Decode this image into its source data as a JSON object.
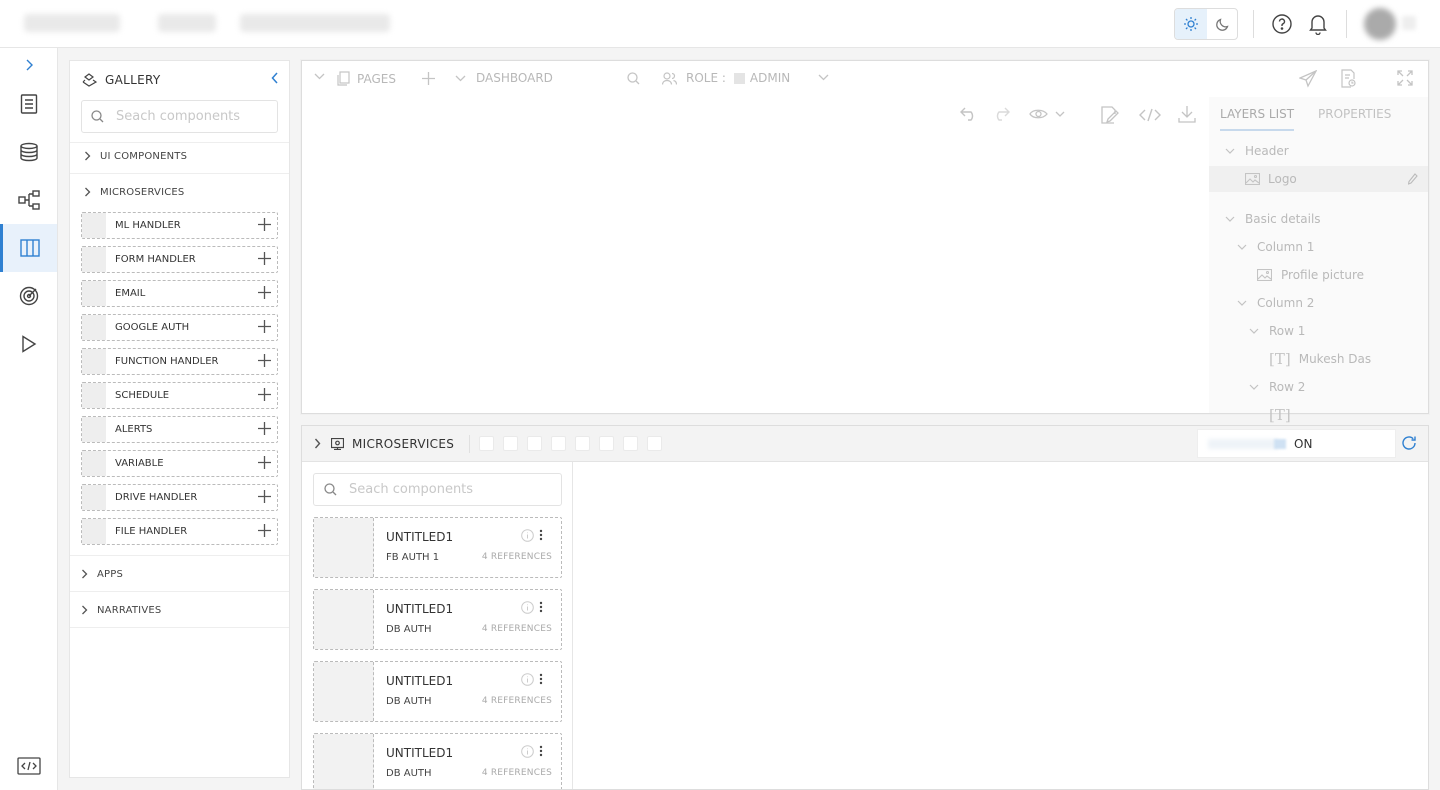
{
  "app": {
    "topbar": {
      "theme_light_icon": "sun-icon",
      "theme_dark_icon": "moon-icon",
      "help_icon": "help-circle-icon",
      "notifications_icon": "bell-icon"
    },
    "leftnav": {
      "active_index": 3,
      "items": [
        "document-icon",
        "database-icon",
        "workflow-icon",
        "layout-columns-icon",
        "target-icon",
        "play-icon"
      ],
      "bottom_icon": "code-icon"
    }
  },
  "gallery": {
    "title": "GALLERY",
    "search_placeholder": "Seach components",
    "sections": {
      "ui_components": "UI COMPONENTS",
      "microservices": "MICROSERVICES",
      "apps": "APPS",
      "narratives": "NARRATIVES"
    },
    "items": [
      "ML HANDLER",
      "FORM HANDLER",
      "EMAIL",
      "GOOGLE AUTH",
      "FUNCTION HANDLER",
      "SCHEDULE",
      "ALERTS",
      "VARIABLE",
      "DRIVE HANDLER",
      "FILE HANDLER"
    ]
  },
  "canvas": {
    "pages_label": "PAGES",
    "dashboard_label": "DASHBOARD",
    "role_label": "ROLE :",
    "role_value": "ADMIN",
    "layers": {
      "tab_layers": "LAYERS LIST",
      "tab_properties": "PROPERTIES",
      "tree": {
        "header": "Header",
        "logo": "Logo",
        "basic_details": "Basic details",
        "column1": "Column 1",
        "profile_picture": "Profile picture",
        "column2": "Column 2",
        "row1": "Row 1",
        "mukesh": "Mukesh Das",
        "row2": "Row 2"
      }
    }
  },
  "microservices": {
    "title": "MICROSERVICES",
    "toggle_value": "ON",
    "search_placeholder": "Seach components",
    "cards": [
      {
        "name": "UNTITLED1",
        "sub": "FB AUTH 1",
        "refs": "4 REFERENCES"
      },
      {
        "name": "UNTITLED1",
        "sub": "DB AUTH",
        "refs": "4 REFERENCES"
      },
      {
        "name": "UNTITLED1",
        "sub": "DB AUTH",
        "refs": "4 REFERENCES"
      },
      {
        "name": "UNTITLED1",
        "sub": "DB AUTH",
        "refs": "4 REFERENCES"
      }
    ]
  },
  "colors": {
    "accent": "#2f80d1",
    "border": "#dddddd"
  }
}
